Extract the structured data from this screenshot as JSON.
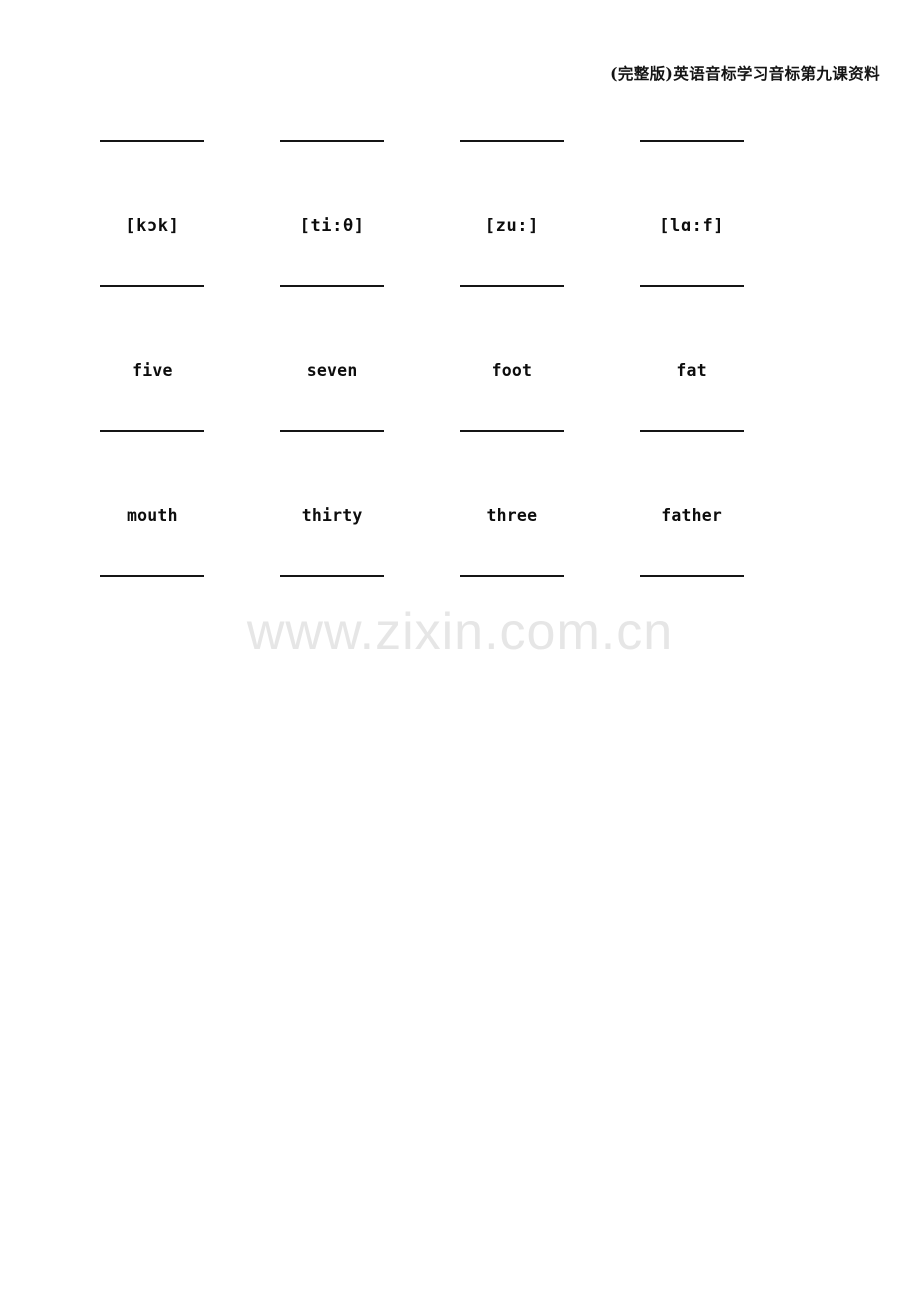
{
  "header": {
    "title": "(完整版)英语音标学习音标第九课资料"
  },
  "watermark": {
    "text": "www.zixin.com.cn"
  },
  "worksheet": {
    "blank_placeholder": "",
    "rows": [
      {
        "kind": "blanks",
        "cells": [
          "",
          "",
          "",
          ""
        ]
      },
      {
        "kind": "prompts",
        "style": "phonetic",
        "cells": [
          "[kɔk]",
          "[ti:θ]",
          "[zu:]",
          "[lɑ:f]"
        ]
      },
      {
        "kind": "blanks",
        "cells": [
          "",
          "",
          "",
          ""
        ]
      },
      {
        "kind": "prompts",
        "style": "word",
        "cells": [
          "five",
          "seven",
          "foot",
          "fat"
        ]
      },
      {
        "kind": "blanks",
        "cells": [
          "",
          "",
          "",
          ""
        ]
      },
      {
        "kind": "prompts",
        "style": "word",
        "cells": [
          "mouth",
          "thirty",
          "three",
          "father"
        ]
      },
      {
        "kind": "blanks",
        "cells": [
          "",
          "",
          "",
          ""
        ]
      }
    ]
  }
}
